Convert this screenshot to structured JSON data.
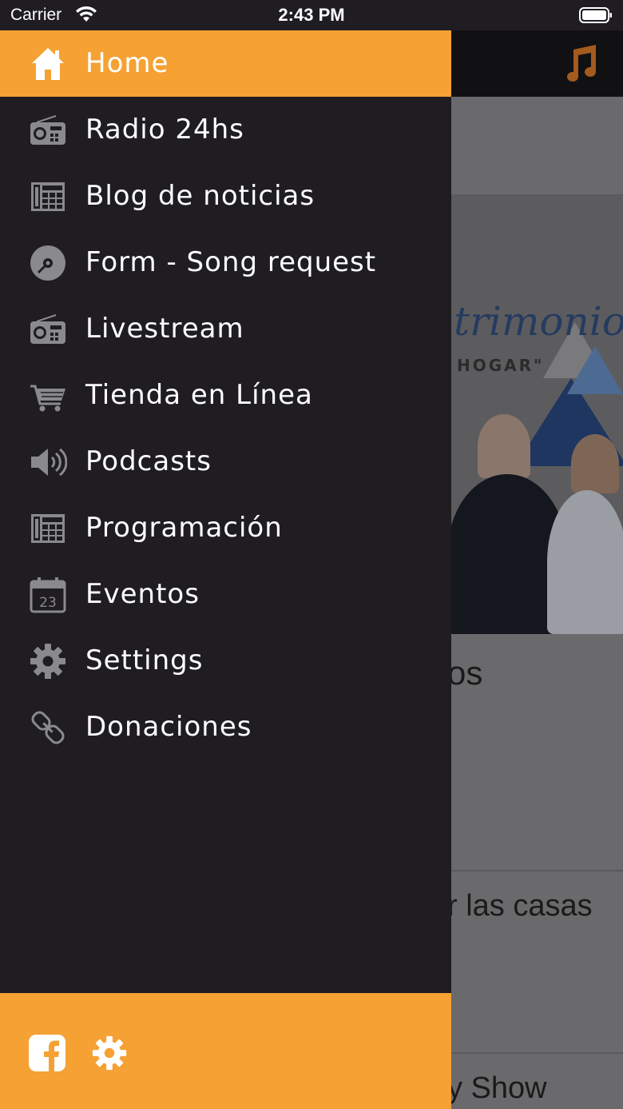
{
  "status_bar": {
    "carrier": "Carrier",
    "time": "2:43 PM"
  },
  "background": {
    "banner_title": "trimonios",
    "banner_subtitle": "HOGAR\"",
    "fragment_1": "os",
    "fragment_2": "r las casas",
    "fragment_3": "y Show"
  },
  "menu": {
    "active_index": 0,
    "items": [
      {
        "label": "Home",
        "icon": "home-icon"
      },
      {
        "label": "Radio 24hs",
        "icon": "radio-icon"
      },
      {
        "label": "Blog de noticias",
        "icon": "news-icon"
      },
      {
        "label": "Form - Song request",
        "icon": "disc-icon"
      },
      {
        "label": "Livestream",
        "icon": "radio-icon"
      },
      {
        "label": "Tienda en Línea",
        "icon": "cart-icon"
      },
      {
        "label": "Podcasts",
        "icon": "speaker-icon"
      },
      {
        "label": "Programación",
        "icon": "news-icon"
      },
      {
        "label": "Eventos",
        "icon": "calendar-icon"
      },
      {
        "label": "Settings",
        "icon": "gear-icon"
      },
      {
        "label": "Donaciones",
        "icon": "link-icon"
      }
    ],
    "calendar_day": "23"
  },
  "footer": {
    "icons": [
      "facebook-icon",
      "gear-icon"
    ]
  },
  "colors": {
    "accent": "#f5a133",
    "drawer_bg": "#1f1d22",
    "icon_gray": "#8a8a8e"
  }
}
